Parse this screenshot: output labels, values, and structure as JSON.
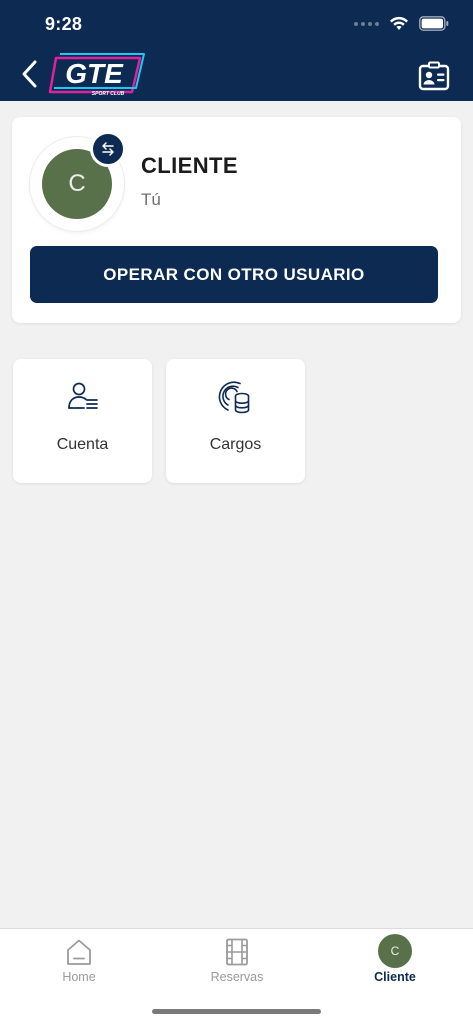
{
  "status_bar": {
    "time": "9:28"
  },
  "header": {
    "logo_text": "GTE",
    "logo_subtext": "SPORT CLUB",
    "back_icon": "chevron-left-icon",
    "card_icon": "contact-card-icon"
  },
  "profile": {
    "avatar_initial": "C",
    "name": "CLIENTE",
    "subtitle": "Tú",
    "swap_icon": "swap-arrows-icon",
    "operate_button_label": "OPERAR CON OTRO USUARIO"
  },
  "tiles": [
    {
      "label": "Cuenta",
      "icon": "user-list-icon"
    },
    {
      "label": "Cargos",
      "icon": "coins-icon"
    }
  ],
  "bottom_nav": {
    "items": [
      {
        "label": "Home",
        "icon": "home-icon",
        "active": false
      },
      {
        "label": "Reservas",
        "icon": "film-icon",
        "active": false
      },
      {
        "label": "Cliente",
        "icon": "avatar",
        "active": true,
        "initial": "C"
      }
    ]
  },
  "colors": {
    "primary": "#0c2a52",
    "avatar": "#59714b",
    "background": "#f1f1f1",
    "logo_accent_pink": "#e0219d",
    "logo_accent_cyan": "#1fc8f0"
  }
}
